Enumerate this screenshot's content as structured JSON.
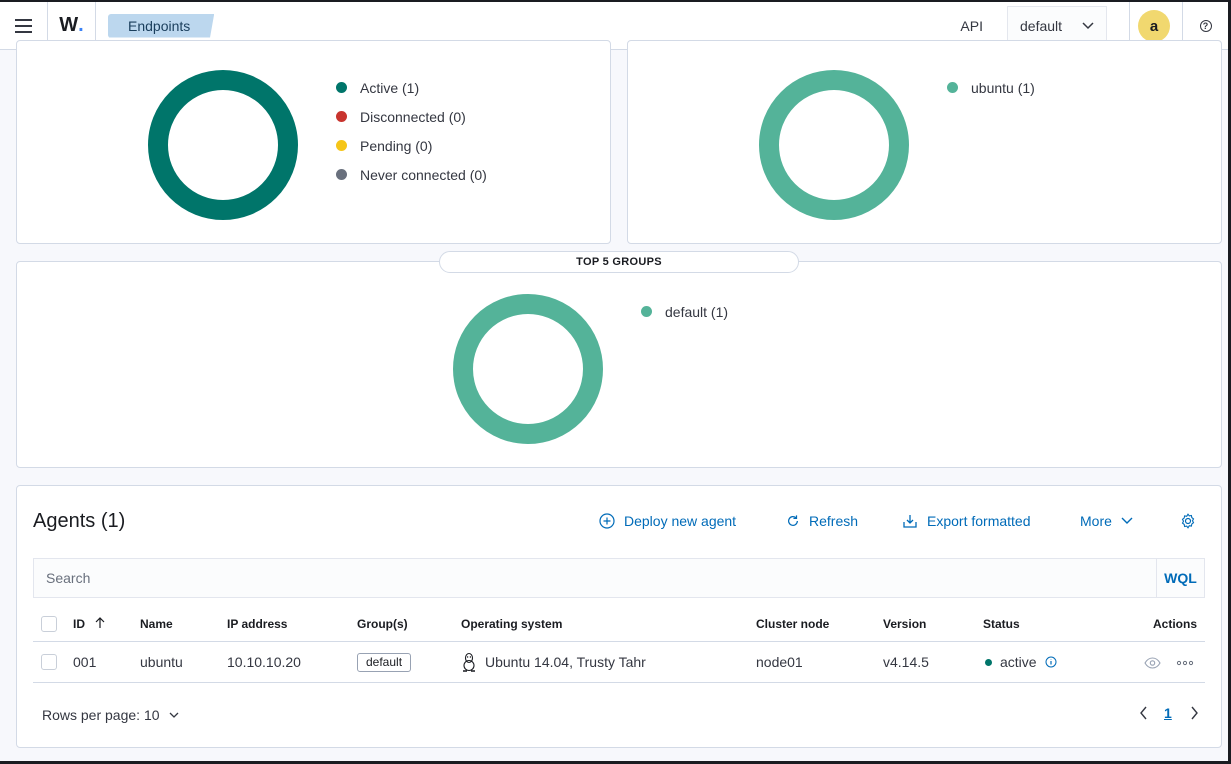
{
  "header": {
    "logo_text": "W",
    "breadcrumb": "Endpoints",
    "api_label": "API",
    "env_selected": "default",
    "avatar_initial": "a",
    "help_symbol": "?"
  },
  "status_panel": {
    "legend": [
      {
        "label": "Active (1)",
        "color": "#00756a"
      },
      {
        "label": "Disconnected (0)",
        "color": "#c8342e"
      },
      {
        "label": "Pending (0)",
        "color": "#f5c518"
      },
      {
        "label": "Never connected (0)",
        "color": "#69707d"
      }
    ]
  },
  "os_panel": {
    "legend": [
      {
        "label": "ubuntu (1)",
        "color": "#54b399"
      }
    ]
  },
  "groups_panel": {
    "title": "TOP 5 GROUPS",
    "legend": [
      {
        "label": "default (1)",
        "color": "#54b399"
      }
    ]
  },
  "chart_data": [
    {
      "type": "pie",
      "categories": [
        "Active",
        "Disconnected",
        "Pending",
        "Never connected"
      ],
      "values": [
        1,
        0,
        0,
        0
      ]
    },
    {
      "type": "pie",
      "categories": [
        "ubuntu"
      ],
      "values": [
        1
      ]
    },
    {
      "type": "pie",
      "title": "TOP 5 GROUPS",
      "categories": [
        "default"
      ],
      "values": [
        1
      ]
    }
  ],
  "agents": {
    "title": "Agents (1)",
    "actions": {
      "deploy": "Deploy new agent",
      "refresh": "Refresh",
      "export": "Export formatted",
      "more": "More"
    },
    "search_placeholder": "Search",
    "wql_label": "WQL",
    "columns": {
      "id": "ID",
      "name": "Name",
      "ip": "IP address",
      "groups": "Group(s)",
      "os": "Operating system",
      "cluster": "Cluster node",
      "version": "Version",
      "status": "Status",
      "actions": "Actions"
    },
    "rows": [
      {
        "id": "001",
        "name": "ubuntu",
        "ip": "10.10.10.20",
        "group": "default",
        "os": "Ubuntu 14.04, Trusty Tahr",
        "cluster": "node01",
        "version": "v4.14.5",
        "status": "active"
      }
    ],
    "rows_per_page": "Rows per page: 10",
    "current_page": "1"
  }
}
